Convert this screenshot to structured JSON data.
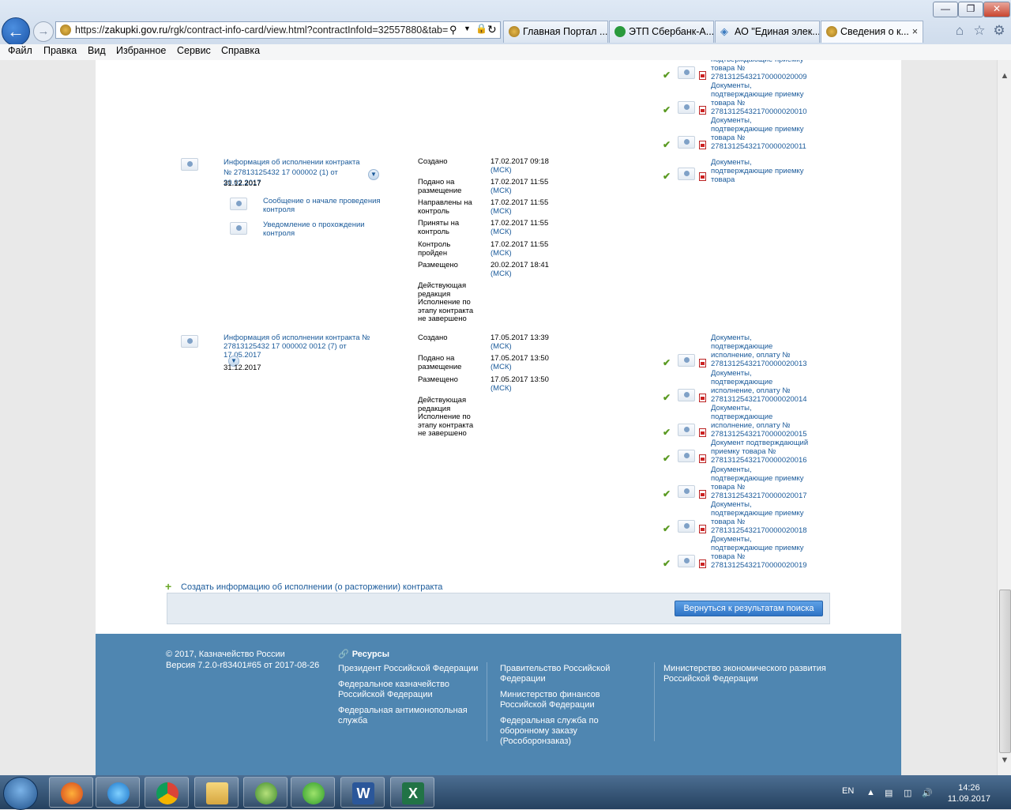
{
  "browser": {
    "url_prefix": "https://",
    "url_host": "zakupki.gov.ru",
    "url_path": "/rgk/contract-info-card/view.html?contractInfoId=32557880&tab=",
    "tabs": [
      {
        "label": "Главная Портал ..."
      },
      {
        "label": "ЭТП Сбербанк-А..."
      },
      {
        "label": "АО \"Единая элек..."
      },
      {
        "label": "Сведения о к..."
      }
    ],
    "close_tab": "×",
    "window_buttons": [
      "—",
      "❐",
      "✕"
    ]
  },
  "menu": [
    "Файл",
    "Правка",
    "Вид",
    "Избранное",
    "Сервис",
    "Справка"
  ],
  "top_docs": [
    {
      "label": "подтверждающие приемку товара № 27813125432170000020009"
    },
    {
      "label": "Документы, подтверждающие приемку товара № 27813125432170000020010"
    },
    {
      "label": "Документы, подтверждающие приемку товара № 27813125432170000020011"
    }
  ],
  "block1": {
    "title": "Информация об исполнении контракта № 27813125432 17 000002 (1) от 20.02.2017",
    "date": "31.12.2017",
    "sublinks": [
      "Сообщение о начале проведения контроля",
      "Уведомление о прохождении контроля"
    ],
    "statuses": [
      {
        "label": "Создано",
        "date": "17.02.2017 09:18",
        "tz": "(МСК)"
      },
      {
        "label": "Подано на размещение",
        "date": "17.02.2017 11:55",
        "tz": "(МСК)"
      },
      {
        "label": "Направлены на контроль",
        "date": "17.02.2017 11:55",
        "tz": "(МСК)"
      },
      {
        "label": "Приняты на контроль",
        "date": "17.02.2017 11:55",
        "tz": "(МСК)"
      },
      {
        "label": "Контроль пройден",
        "date": "17.02.2017 11:55",
        "tz": "(МСК)"
      },
      {
        "label": "Размещено",
        "date": "20.02.2017 18:41",
        "tz": "(МСК)"
      }
    ],
    "edition": "Действующая редакция Исполнение по этапу контракта не завершено",
    "doc": "Документы, подтверждающие приемку товара"
  },
  "block2": {
    "title": "Информация об исполнении контракта № 27813125432 17 000002 0012 (7) от 17.05.2017",
    "date": "31.12.2017",
    "statuses": [
      {
        "label": "Создано",
        "date": "17.05.2017 13:39",
        "tz": "(МСК)"
      },
      {
        "label": "Подано на размещение",
        "date": "17.05.2017 13:50",
        "tz": "(МСК)"
      },
      {
        "label": "Размещено",
        "date": "17.05.2017 13:50",
        "tz": "(МСК)"
      }
    ],
    "edition": "Действующая редакция Исполнение по этапу контракта не завершено",
    "docs": [
      "Документы, подтверждающие исполнение, оплату № 27813125432170000020013",
      "Документы, подтверждающие исполнение, оплату № 27813125432170000020014",
      "Документы, подтверждающие исполнение, оплату № 27813125432170000020015",
      "Документ подтверждающий приемку товара № 27813125432170000020016",
      "Документы, подтверждающие приемку товара № 27813125432170000020017",
      "Документы, подтверждающие приемку товара № 27813125432170000020018",
      "Документы, подтверждающие приемку товара № 27813125432170000020019"
    ]
  },
  "create_link": "Создать информацию об исполнении (о расторжении) контракта",
  "back_button": "Вернуться к результатам поиска",
  "footer": {
    "copyright": "© 2017, Казначейство России",
    "version": "Версия 7.2.0-r83401#65 от 2017-08-26",
    "resources_title": "Ресурсы",
    "col1": [
      "Президент Российской Федерации",
      "Федеральное казначейство Российской Федерации",
      "Федеральная антимонопольная служба"
    ],
    "col2": [
      "Правительство Российской Федерации",
      "Министерство финансов Российской Федерации",
      "Федеральная служба по оборонному заказу (Рособоронзаказ)"
    ],
    "col3": [
      "Министерство экономического развития Российской Федерации"
    ]
  },
  "taskbar": {
    "lang": "EN",
    "time": "14:26",
    "date": "11.09.2017"
  },
  "colors": {
    "link": "#1a5a9a",
    "footer_bg": "#4f86b1",
    "button": "#2f74c6"
  }
}
